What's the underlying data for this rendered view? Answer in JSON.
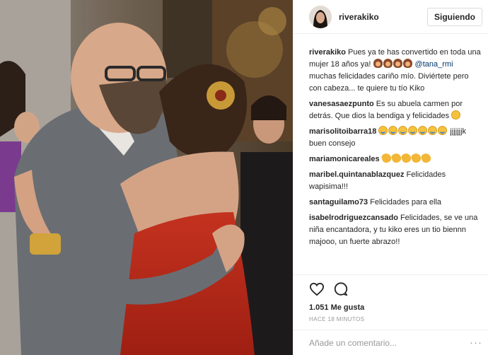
{
  "post": {
    "username": "riverakiko",
    "follow_label": "Siguiendo",
    "likes": "1.051 Me gusta",
    "time": "HACE 18 MINUTOS",
    "comment_placeholder": "Añade un comentario...",
    "more_label": "···"
  },
  "comments": [
    {
      "user": "riverakiko",
      "parts": [
        {
          "t": "text",
          "v": "Pues ya te has convertido en toda una mujer 18 años ya! "
        },
        {
          "t": "emoji",
          "v": "woman"
        },
        {
          "t": "emoji",
          "v": "woman"
        },
        {
          "t": "emoji",
          "v": "woman"
        },
        {
          "t": "emoji",
          "v": "woman"
        },
        {
          "t": "mention",
          "v": " @tana_rmi"
        },
        {
          "t": "text",
          "v": " muchas felicidades cariño mío. Diviértete pero con cabeza... te quiere tu tío Kiko"
        }
      ]
    },
    {
      "user": "vanesasaezpunto",
      "parts": [
        {
          "t": "text",
          "v": "Es su abuela carmen por detrás. Que dios la bendiga y felicidades "
        },
        {
          "t": "emoji",
          "v": "smile"
        }
      ]
    },
    {
      "user": "marisolitoibarra18",
      "parts": [
        {
          "t": "emoji",
          "v": "joy"
        },
        {
          "t": "emoji",
          "v": "joy"
        },
        {
          "t": "emoji",
          "v": "joy"
        },
        {
          "t": "emoji",
          "v": "joy"
        },
        {
          "t": "emoji",
          "v": "joy"
        },
        {
          "t": "emoji",
          "v": "joy"
        },
        {
          "t": "emoji",
          "v": "joy"
        },
        {
          "t": "text",
          "v": " jjjjjjjk buen consejo"
        }
      ]
    },
    {
      "user": "mariamonicareales",
      "parts": [
        {
          "t": "emoji",
          "v": "clap"
        },
        {
          "t": "emoji",
          "v": "clap"
        },
        {
          "t": "emoji",
          "v": "clap"
        },
        {
          "t": "emoji",
          "v": "clap"
        },
        {
          "t": "emoji",
          "v": "clap"
        }
      ]
    },
    {
      "user": "maribel.quintanablazquez",
      "parts": [
        {
          "t": "text",
          "v": "Felicidades wapisima!!!"
        }
      ]
    },
    {
      "user": "santaguilamo73",
      "parts": [
        {
          "t": "text",
          "v": "Felicidades para ella"
        }
      ]
    },
    {
      "user": "isabelrodriguezcansado",
      "parts": [
        {
          "t": "text",
          "v": "Felicidades, se ve una niña encantadora, y tu kiko eres un tio biennn majooo, un fuerte abrazo!!"
        }
      ]
    }
  ]
}
